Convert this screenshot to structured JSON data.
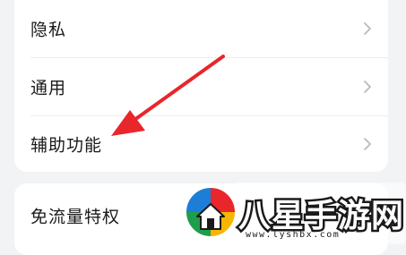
{
  "settings_group_1": {
    "items": [
      {
        "label": "隐私"
      },
      {
        "label": "通用"
      },
      {
        "label": "辅助功能"
      }
    ]
  },
  "settings_group_2": {
    "items": [
      {
        "label": "免流量特权"
      }
    ]
  },
  "annotation": {
    "arrow_color": "#e8262b"
  },
  "watermark": {
    "brand": "八星手游网",
    "url": "www.lyshbx.com"
  },
  "icons": {
    "row_chevron": "chevron-right-icon",
    "watermark_logo": "house-logo-icon"
  }
}
